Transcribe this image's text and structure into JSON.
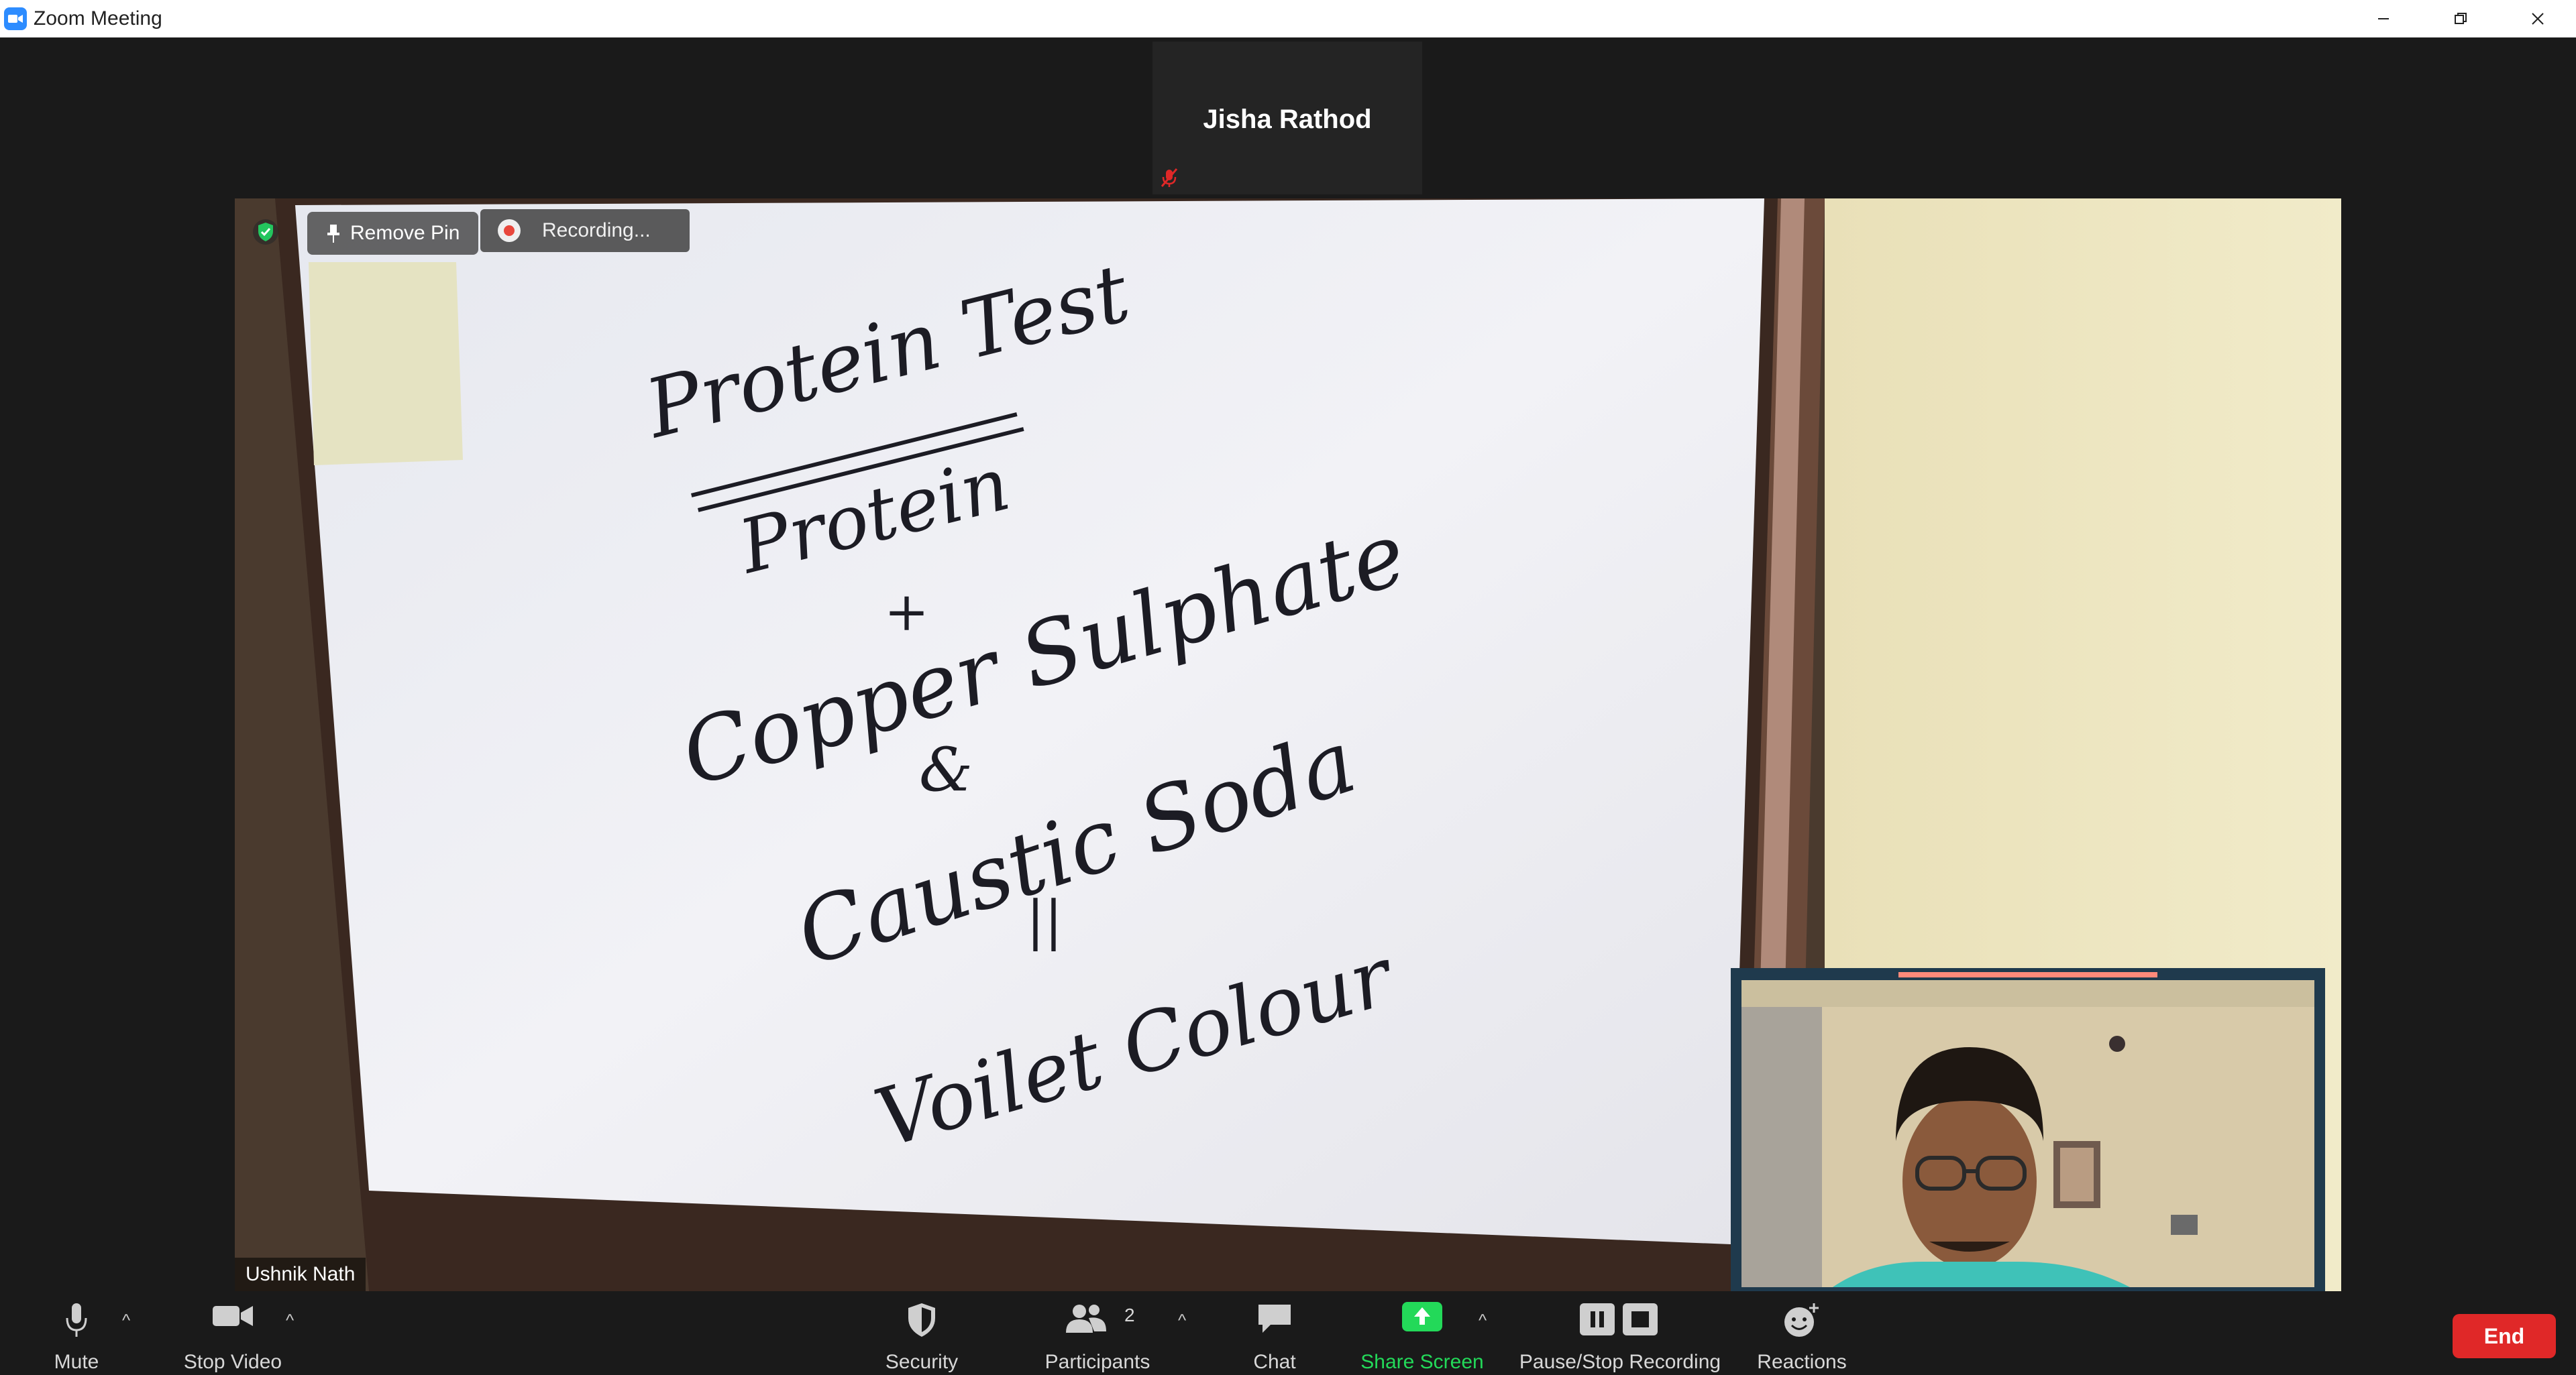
{
  "window": {
    "title": "Zoom Meeting",
    "controls": [
      "minimize",
      "restore",
      "close"
    ]
  },
  "participants": {
    "top_tile_name": "Jisha Rathod",
    "main_name": "Ushnik Nath"
  },
  "overlay": {
    "pin_label": "Remove Pin",
    "recording_label": "Recording..."
  },
  "whiteboard": {
    "lines": [
      "Protein Test",
      "Protein",
      "+",
      "Copper Sulphate",
      "&",
      "Caustic Soda",
      "||",
      "Voilet Colour"
    ]
  },
  "toolbar": {
    "mute": "Mute",
    "video": "Stop Video",
    "security": "Security",
    "participants": "Participants",
    "participants_count": "2",
    "chat": "Chat",
    "share": "Share Screen",
    "record": "Pause/Stop Recording",
    "reactions": "Reactions",
    "end": "End"
  },
  "colors": {
    "accent_blue": "#2d8cff",
    "share_green": "#23d959",
    "end_red": "#e02828",
    "rec_red": "#e8473c"
  }
}
